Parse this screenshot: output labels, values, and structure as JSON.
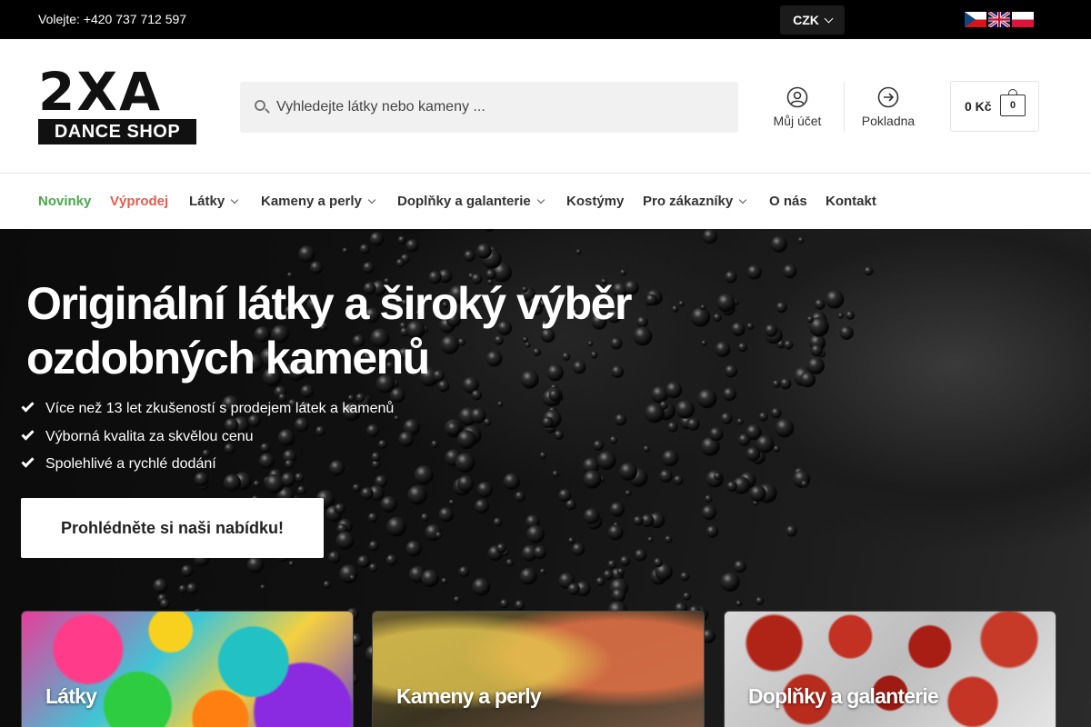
{
  "topbar": {
    "phone": "Volejte: +420 737 712 597",
    "currency": "CZK",
    "flags": [
      "cz-flag-icon",
      "en-flag-icon",
      "pl-flag-icon"
    ]
  },
  "header": {
    "logo": {
      "big": "2XA",
      "sub": "DANCE SHOP"
    },
    "search_placeholder": "Vyhledejte látky nebo kameny ...",
    "account_label": "Můj účet",
    "checkout_label": "Pokladna",
    "cart_amount": "0 Kč",
    "cart_count": "0"
  },
  "nav": {
    "items": [
      {
        "label": "Novinky",
        "color": "#4ba84a"
      },
      {
        "label": "Výprodej",
        "color": "#e35c4f"
      },
      {
        "label": "Látky"
      },
      {
        "label": "Kameny a perly"
      },
      {
        "label": "Doplňky a galanterie"
      },
      {
        "label": "Kostýmy"
      },
      {
        "label": "Pro zákazníky"
      },
      {
        "label": "O nás"
      },
      {
        "label": "Kontakt"
      }
    ]
  },
  "hero": {
    "title": "Originální látky a široký výběr ozdobných kamenů",
    "bullets": [
      "Více než 13 let zkušeností s prodejem látek a kamenů",
      "Výborná kvalita za skvělou cenu",
      "Spolehlivé a rychlé dodání"
    ],
    "cta": "Prohlédněte si naši nabídku!"
  },
  "cards": [
    {
      "title": "Látky"
    },
    {
      "title": "Kameny a perly"
    },
    {
      "title": "Doplňky a galanterie"
    }
  ]
}
